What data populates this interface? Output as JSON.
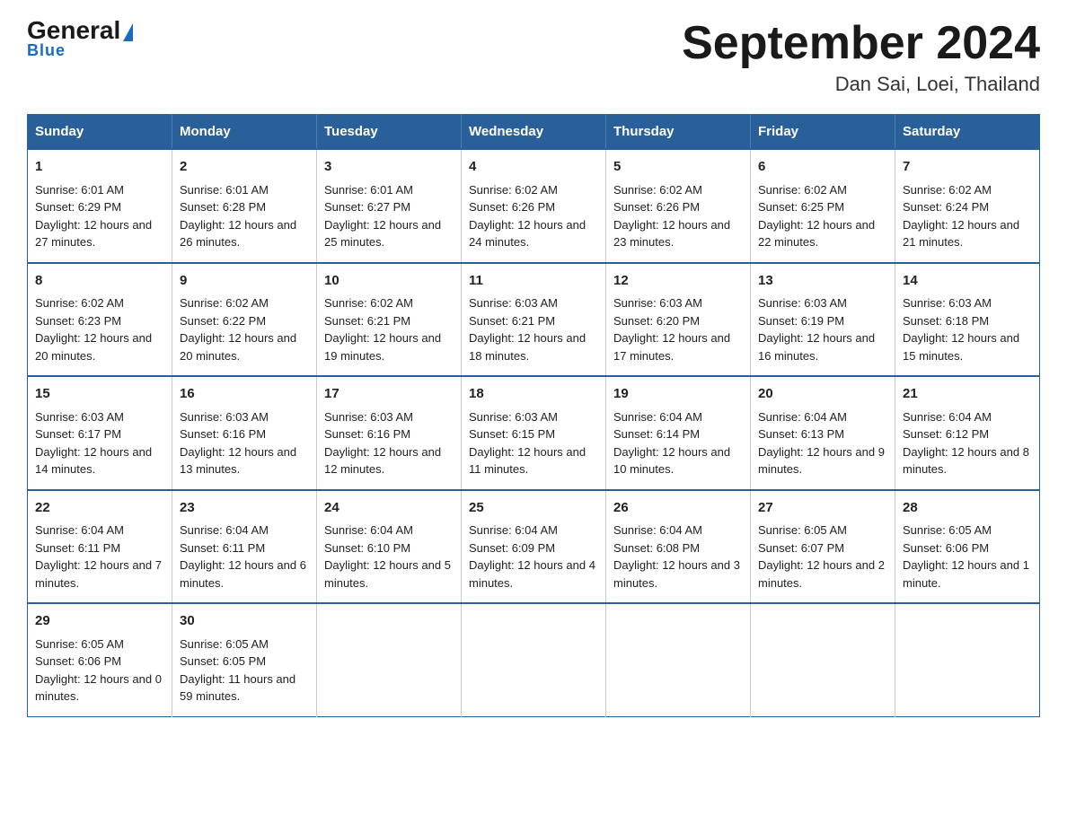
{
  "logo": {
    "text_general": "General",
    "text_blue": "Blue",
    "tagline": "Blue"
  },
  "header": {
    "month_year": "September 2024",
    "location": "Dan Sai, Loei, Thailand"
  },
  "columns": [
    "Sunday",
    "Monday",
    "Tuesday",
    "Wednesday",
    "Thursday",
    "Friday",
    "Saturday"
  ],
  "weeks": [
    [
      {
        "day": "1",
        "sunrise": "Sunrise: 6:01 AM",
        "sunset": "Sunset: 6:29 PM",
        "daylight": "Daylight: 12 hours and 27 minutes."
      },
      {
        "day": "2",
        "sunrise": "Sunrise: 6:01 AM",
        "sunset": "Sunset: 6:28 PM",
        "daylight": "Daylight: 12 hours and 26 minutes."
      },
      {
        "day": "3",
        "sunrise": "Sunrise: 6:01 AM",
        "sunset": "Sunset: 6:27 PM",
        "daylight": "Daylight: 12 hours and 25 minutes."
      },
      {
        "day": "4",
        "sunrise": "Sunrise: 6:02 AM",
        "sunset": "Sunset: 6:26 PM",
        "daylight": "Daylight: 12 hours and 24 minutes."
      },
      {
        "day": "5",
        "sunrise": "Sunrise: 6:02 AM",
        "sunset": "Sunset: 6:26 PM",
        "daylight": "Daylight: 12 hours and 23 minutes."
      },
      {
        "day": "6",
        "sunrise": "Sunrise: 6:02 AM",
        "sunset": "Sunset: 6:25 PM",
        "daylight": "Daylight: 12 hours and 22 minutes."
      },
      {
        "day": "7",
        "sunrise": "Sunrise: 6:02 AM",
        "sunset": "Sunset: 6:24 PM",
        "daylight": "Daylight: 12 hours and 21 minutes."
      }
    ],
    [
      {
        "day": "8",
        "sunrise": "Sunrise: 6:02 AM",
        "sunset": "Sunset: 6:23 PM",
        "daylight": "Daylight: 12 hours and 20 minutes."
      },
      {
        "day": "9",
        "sunrise": "Sunrise: 6:02 AM",
        "sunset": "Sunset: 6:22 PM",
        "daylight": "Daylight: 12 hours and 20 minutes."
      },
      {
        "day": "10",
        "sunrise": "Sunrise: 6:02 AM",
        "sunset": "Sunset: 6:21 PM",
        "daylight": "Daylight: 12 hours and 19 minutes."
      },
      {
        "day": "11",
        "sunrise": "Sunrise: 6:03 AM",
        "sunset": "Sunset: 6:21 PM",
        "daylight": "Daylight: 12 hours and 18 minutes."
      },
      {
        "day": "12",
        "sunrise": "Sunrise: 6:03 AM",
        "sunset": "Sunset: 6:20 PM",
        "daylight": "Daylight: 12 hours and 17 minutes."
      },
      {
        "day": "13",
        "sunrise": "Sunrise: 6:03 AM",
        "sunset": "Sunset: 6:19 PM",
        "daylight": "Daylight: 12 hours and 16 minutes."
      },
      {
        "day": "14",
        "sunrise": "Sunrise: 6:03 AM",
        "sunset": "Sunset: 6:18 PM",
        "daylight": "Daylight: 12 hours and 15 minutes."
      }
    ],
    [
      {
        "day": "15",
        "sunrise": "Sunrise: 6:03 AM",
        "sunset": "Sunset: 6:17 PM",
        "daylight": "Daylight: 12 hours and 14 minutes."
      },
      {
        "day": "16",
        "sunrise": "Sunrise: 6:03 AM",
        "sunset": "Sunset: 6:16 PM",
        "daylight": "Daylight: 12 hours and 13 minutes."
      },
      {
        "day": "17",
        "sunrise": "Sunrise: 6:03 AM",
        "sunset": "Sunset: 6:16 PM",
        "daylight": "Daylight: 12 hours and 12 minutes."
      },
      {
        "day": "18",
        "sunrise": "Sunrise: 6:03 AM",
        "sunset": "Sunset: 6:15 PM",
        "daylight": "Daylight: 12 hours and 11 minutes."
      },
      {
        "day": "19",
        "sunrise": "Sunrise: 6:04 AM",
        "sunset": "Sunset: 6:14 PM",
        "daylight": "Daylight: 12 hours and 10 minutes."
      },
      {
        "day": "20",
        "sunrise": "Sunrise: 6:04 AM",
        "sunset": "Sunset: 6:13 PM",
        "daylight": "Daylight: 12 hours and 9 minutes."
      },
      {
        "day": "21",
        "sunrise": "Sunrise: 6:04 AM",
        "sunset": "Sunset: 6:12 PM",
        "daylight": "Daylight: 12 hours and 8 minutes."
      }
    ],
    [
      {
        "day": "22",
        "sunrise": "Sunrise: 6:04 AM",
        "sunset": "Sunset: 6:11 PM",
        "daylight": "Daylight: 12 hours and 7 minutes."
      },
      {
        "day": "23",
        "sunrise": "Sunrise: 6:04 AM",
        "sunset": "Sunset: 6:11 PM",
        "daylight": "Daylight: 12 hours and 6 minutes."
      },
      {
        "day": "24",
        "sunrise": "Sunrise: 6:04 AM",
        "sunset": "Sunset: 6:10 PM",
        "daylight": "Daylight: 12 hours and 5 minutes."
      },
      {
        "day": "25",
        "sunrise": "Sunrise: 6:04 AM",
        "sunset": "Sunset: 6:09 PM",
        "daylight": "Daylight: 12 hours and 4 minutes."
      },
      {
        "day": "26",
        "sunrise": "Sunrise: 6:04 AM",
        "sunset": "Sunset: 6:08 PM",
        "daylight": "Daylight: 12 hours and 3 minutes."
      },
      {
        "day": "27",
        "sunrise": "Sunrise: 6:05 AM",
        "sunset": "Sunset: 6:07 PM",
        "daylight": "Daylight: 12 hours and 2 minutes."
      },
      {
        "day": "28",
        "sunrise": "Sunrise: 6:05 AM",
        "sunset": "Sunset: 6:06 PM",
        "daylight": "Daylight: 12 hours and 1 minute."
      }
    ],
    [
      {
        "day": "29",
        "sunrise": "Sunrise: 6:05 AM",
        "sunset": "Sunset: 6:06 PM",
        "daylight": "Daylight: 12 hours and 0 minutes."
      },
      {
        "day": "30",
        "sunrise": "Sunrise: 6:05 AM",
        "sunset": "Sunset: 6:05 PM",
        "daylight": "Daylight: 11 hours and 59 minutes."
      },
      null,
      null,
      null,
      null,
      null
    ]
  ]
}
